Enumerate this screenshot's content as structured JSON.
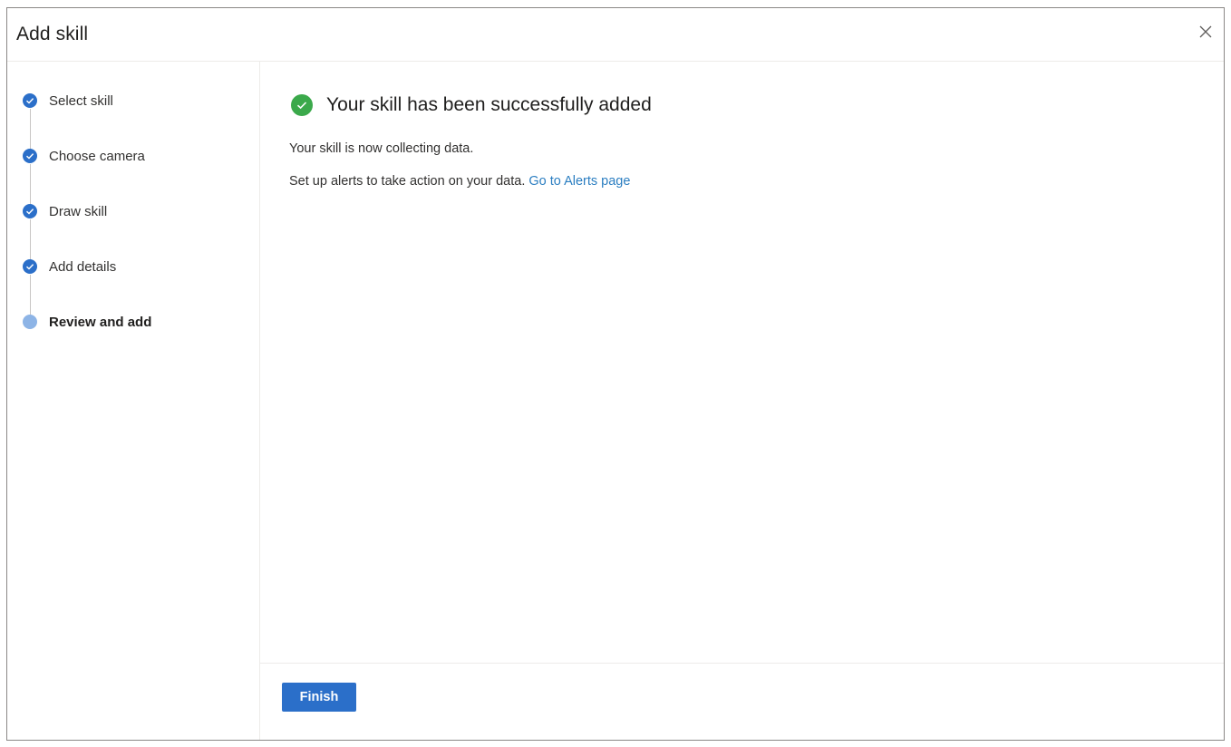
{
  "dialog": {
    "title": "Add skill",
    "close_icon": "close-icon"
  },
  "steps": [
    {
      "label": "Select skill",
      "status": "completed"
    },
    {
      "label": "Choose camera",
      "status": "completed"
    },
    {
      "label": "Draw skill",
      "status": "completed"
    },
    {
      "label": "Add details",
      "status": "completed"
    },
    {
      "label": "Review and add",
      "status": "current"
    }
  ],
  "main": {
    "success_icon": "checkmark-circle-icon",
    "success_title": "Your skill has been successfully added",
    "collecting_text": "Your skill is now collecting data.",
    "alerts_text": "Set up alerts to take action on your data.",
    "alerts_link": "Go to Alerts page"
  },
  "footer": {
    "finish_label": "Finish"
  },
  "colors": {
    "accent": "#2b6fc9",
    "current_step": "#8db4e6",
    "success": "#3ba94b",
    "link": "#2b7ec1"
  }
}
